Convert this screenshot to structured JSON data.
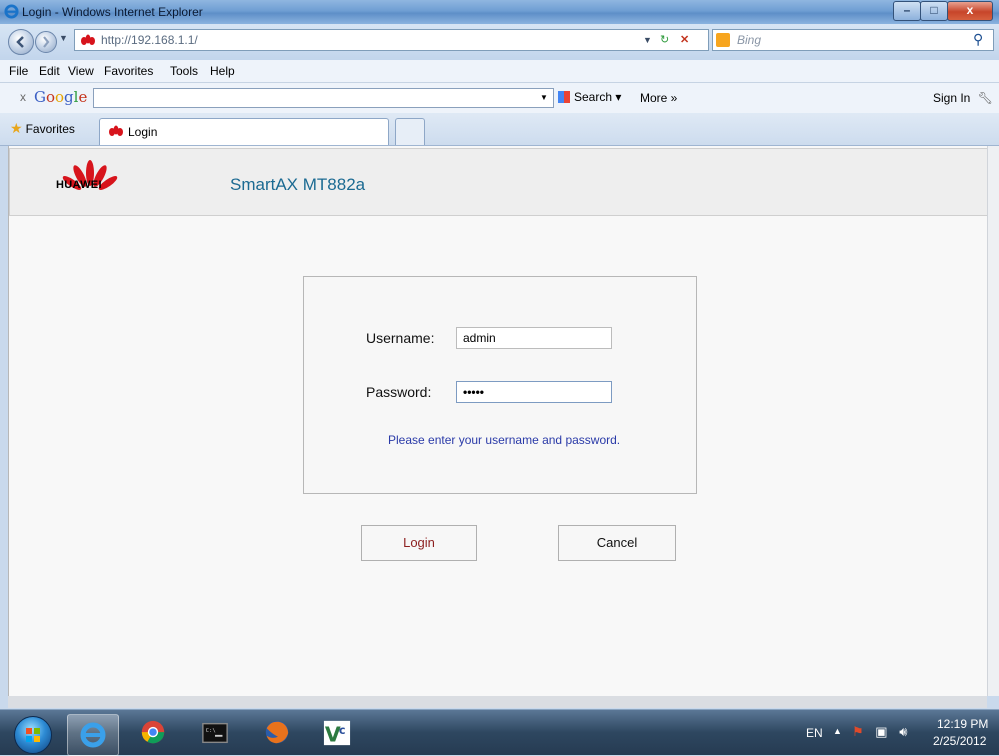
{
  "window": {
    "title": "Login - Windows Internet Explorer",
    "controls": {
      "minimize": "–",
      "maximize": "□",
      "close": "x"
    }
  },
  "address_bar": {
    "url": "http://192.168.1.1/",
    "search_provider": "Bing"
  },
  "menu": {
    "items": [
      "File",
      "Edit",
      "View",
      "Favorites",
      "Tools",
      "Help"
    ]
  },
  "google_toolbar": {
    "close": "x",
    "logo": "Google",
    "search_label": "Search",
    "more_label": "More »",
    "sign_in_label": "Sign In"
  },
  "favorites_bar": {
    "favorites_label": "Favorites",
    "tabs": [
      {
        "label": "Login"
      }
    ]
  },
  "page": {
    "brand": "HUAWEI",
    "product": "SmartAX MT882a",
    "login_form": {
      "username_label": "Username:",
      "username_value": "admin",
      "password_label": "Password:",
      "password_value": "•••••",
      "hint": "Please enter your username and password."
    },
    "buttons": {
      "login": "Login",
      "cancel": "Cancel"
    }
  },
  "taskbar": {
    "language": "EN",
    "time": "12:19 PM",
    "date": "2/25/2012",
    "pinned": [
      "internet-explorer-icon",
      "chrome-icon",
      "command-prompt-icon",
      "firefox-icon",
      "vnc-icon"
    ]
  },
  "colors": {
    "product_text": "#1b6a92",
    "hint_text": "#2a3aa8",
    "login_text": "#8c1e1e",
    "huawei_red": "#d7141c"
  }
}
